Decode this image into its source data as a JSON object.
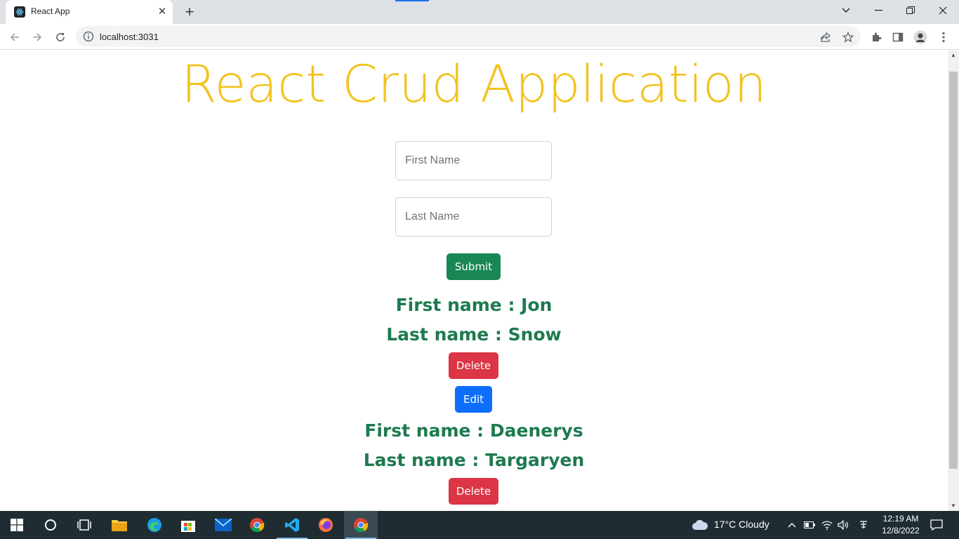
{
  "browser": {
    "tab_title": "React App",
    "url": "localhost:3031"
  },
  "page": {
    "title": "React Crud Application",
    "first_name_placeholder": "First Name",
    "last_name_placeholder": "Last Name",
    "submit_label": "Submit",
    "entries": [
      {
        "first": "First name : Jon",
        "last": "Last name : Snow",
        "delete_label": "Delete",
        "edit_label": "Edit"
      },
      {
        "first": "First name : Daenerys",
        "last": "Last name : Targaryen",
        "delete_label": "Delete"
      }
    ]
  },
  "taskbar": {
    "weather": "17°C  Cloudy",
    "time": "12:19 AM",
    "date": "12/8/2022"
  },
  "colors": {
    "title": "#f3c21f",
    "name_text": "#1e7a4f",
    "submit": "#198754",
    "delete": "#dc3545",
    "edit": "#0d6efd"
  }
}
